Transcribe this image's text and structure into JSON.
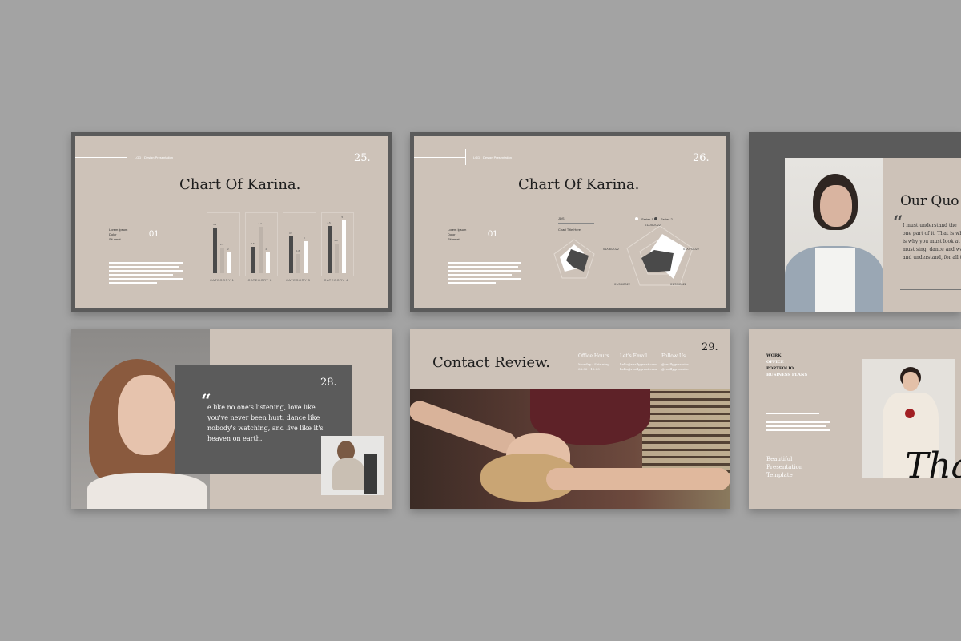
{
  "slides": [
    {
      "id": "slide-25",
      "header": {
        "tag": "LGD",
        "label": "Design Presentation"
      },
      "page_number": "25.",
      "title": "Chart Of Karina.",
      "side": {
        "lines": [
          "Lorem Ipsum",
          "Dolor",
          "Sit amet."
        ],
        "number": "01"
      },
      "chart_data": {
        "type": "bar",
        "categories": [
          "CATEGORY 1",
          "CATEGORY 2",
          "CATEGORY 3",
          "CATEGORY 4"
        ],
        "series": [
          {
            "values": [
              4.3,
              2.5,
              3.5,
              4.5
            ]
          },
          {
            "values": [
              2.4,
              4.4,
              1.8,
              2.8
            ]
          },
          {
            "values": [
              2,
              2,
              3,
              5
            ]
          }
        ],
        "ylim": [
          0,
          5
        ],
        "colors": [
          "#4a4a4a",
          "#bdb3aa",
          "#ffffff"
        ]
      }
    },
    {
      "id": "slide-26",
      "header": {
        "tag": "LGD",
        "label": "Design Presentation"
      },
      "page_number": "26.",
      "title": "Chart Of Karina.",
      "side": {
        "lines": [
          "Lorem Ipsum",
          "Dolor",
          "Sit amet."
        ],
        "number": "01"
      },
      "legend": [
        "Series 1",
        "Series 2"
      ],
      "small_chart_label": "JDS",
      "small_chart_caption": "Chart Title Here",
      "radar_labels": [
        "01/05/2022",
        "01/06/2022",
        "01/07/2022",
        "01/08/2022",
        "01/09/2022"
      ]
    },
    {
      "id": "slide-27",
      "title": "Our Quo",
      "quote_lines": [
        "I must understand the",
        "one part of it. That is wh",
        "is why you must look at th",
        "must sing, dance and wa",
        "and understand, for all th"
      ]
    },
    {
      "id": "slide-28",
      "page_number": "28.",
      "quote_lines": [
        "e like no one's listening, love like",
        "you've never been hurt, dance like",
        "nobody's watching, and live like it's",
        "heaven on earth."
      ]
    },
    {
      "id": "slide-29",
      "page_number": "29.",
      "title": "Contact Review.",
      "contacts": [
        {
          "heading": "Office Hours",
          "lines": [
            "Monday - Saturday",
            "08.00 - 16.00"
          ]
        },
        {
          "heading": "Let's Email",
          "lines": [
            "hello@reallygreat.com",
            "hello@reallygreat.com"
          ]
        },
        {
          "heading": "Follow Us",
          "lines": [
            "@reallygreatsite",
            "@reallygreatsite"
          ]
        }
      ]
    },
    {
      "id": "slide-30",
      "menu": [
        "WORK",
        "OFFICE",
        "PORTFOLIO",
        "BUSINESS PLANS"
      ],
      "footer_lines": [
        "Beautiful",
        "Presentation",
        "Template"
      ],
      "script_word": "Tha"
    }
  ]
}
